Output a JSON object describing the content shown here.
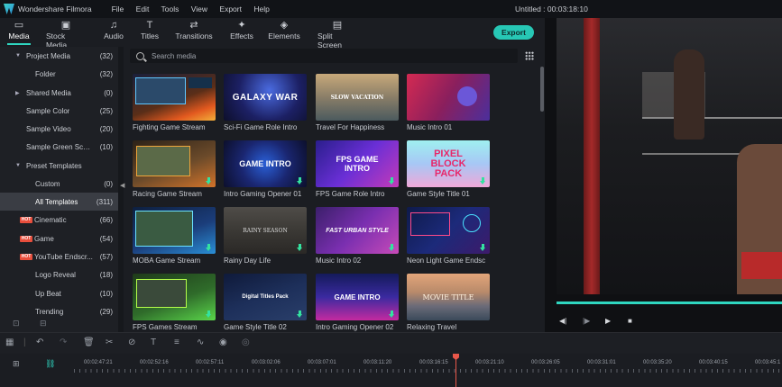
{
  "titlebar": {
    "app_name": "Wondershare Filmora",
    "menu": [
      "File",
      "Edit",
      "Tools",
      "View",
      "Export",
      "Help"
    ],
    "doc_title": "Untitled : 00:03:18:10"
  },
  "toolbar": {
    "tabs": [
      {
        "label": "Media",
        "icon": "folder-icon",
        "active": true
      },
      {
        "label": "Stock Media",
        "icon": "stock-media-icon",
        "active": false
      },
      {
        "label": "Audio",
        "icon": "music-note-icon",
        "active": false
      },
      {
        "label": "Titles",
        "icon": "titles-icon",
        "active": false
      },
      {
        "label": "Transitions",
        "icon": "transitions-icon",
        "active": false
      },
      {
        "label": "Effects",
        "icon": "effects-icon",
        "active": false
      },
      {
        "label": "Elements",
        "icon": "elements-icon",
        "active": false
      },
      {
        "label": "Split Screen",
        "icon": "split-screen-icon",
        "active": false
      }
    ],
    "export_label": "Export",
    "accent_color": "#27c7b5"
  },
  "sidebar": {
    "items": [
      {
        "label": "Project Media",
        "count": "(32)",
        "arrow": "▼"
      },
      {
        "label": "Folder",
        "count": "(32)"
      },
      {
        "label": "Shared Media",
        "count": "(0)",
        "arrow": "▶"
      },
      {
        "label": "Sample Color",
        "count": "(25)"
      },
      {
        "label": "Sample Video",
        "count": "(20)"
      },
      {
        "label": "Sample Green Scre...",
        "count": "(10)"
      },
      {
        "label": "Preset Templates",
        "count": "",
        "arrow": "▼"
      },
      {
        "label": "Custom",
        "count": "(0)"
      },
      {
        "label": "All Templates",
        "count": "(311)",
        "selected": true
      },
      {
        "label": "Cinematic",
        "count": "(66)",
        "hot": true
      },
      {
        "label": "Game",
        "count": "(54)",
        "hot": true
      },
      {
        "label": "YouTube Endscr...",
        "count": "(57)",
        "hot": true
      },
      {
        "label": "Logo Reveal",
        "count": "(18)"
      },
      {
        "label": "Up Beat",
        "count": "(10)"
      },
      {
        "label": "Trending",
        "count": "(29)"
      }
    ],
    "hot_badge": "HOT"
  },
  "search": {
    "placeholder": "Search media"
  },
  "templates": [
    {
      "label": "Fighting Game Stream",
      "text": ""
    },
    {
      "label": "Sci-Fi Game Role Intro",
      "text": "GALAXY WAR"
    },
    {
      "label": "Travel For Happiness",
      "text": "SLOW VACATION"
    },
    {
      "label": "Music Intro 01",
      "text": ""
    },
    {
      "label": "Racing Game Stream",
      "text": ""
    },
    {
      "label": "Intro Gaming Opener 01",
      "text": "GAME INTRO"
    },
    {
      "label": "FPS Game Role Intro",
      "text": "FPS GAME INTRO"
    },
    {
      "label": "Game Style Title 01",
      "text": "PIXEL BLOCK PACK"
    },
    {
      "label": "MOBA Game Stream",
      "text": ""
    },
    {
      "label": "Rainy Day Life",
      "text": "RAINY SEASON"
    },
    {
      "label": "Music Intro 02",
      "text": "FAST URBAN STYLE"
    },
    {
      "label": "Neon Light Game Endsc",
      "text": ""
    },
    {
      "label": "FPS Games Stream",
      "text": ""
    },
    {
      "label": "Game Style Title 02",
      "text": "Digital Titles Pack"
    },
    {
      "label": "Intro Gaming Opener 02",
      "text": "GAME INTRO"
    },
    {
      "label": "Relaxing Travel",
      "text": "MOVIE TITLE"
    }
  ],
  "timeline": {
    "timecodes": [
      "00:02:47:21",
      "00:02:52:16",
      "00:02:57:11",
      "00:03:02:06",
      "00:03:07:01",
      "00:03:11:20",
      "00:03:16:15",
      "00:03:21:10",
      "00:03:26:05",
      "00:03:31:01",
      "00:03:35:20",
      "00:03:40:15",
      "00:03:45:1"
    ],
    "playhead_color": "#e8574a"
  }
}
